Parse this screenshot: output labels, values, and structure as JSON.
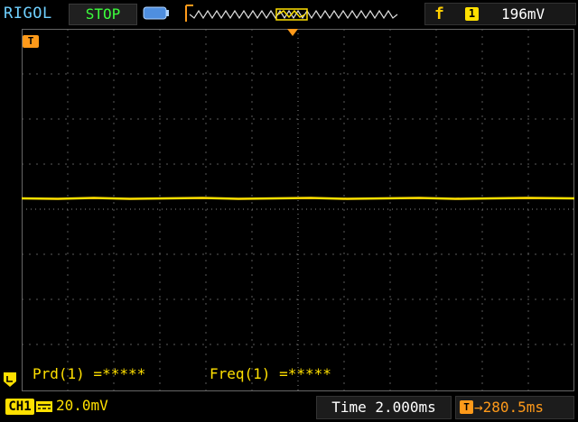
{
  "header": {
    "brand": "RIGOL",
    "run_state": "STOP",
    "trigger_edge_glyph": "f",
    "trigger_channel": "1",
    "trigger_level": "196mV"
  },
  "markers": {
    "trigger_marker": "T"
  },
  "measurements": {
    "period": "Prd(1) =*****",
    "frequency": "Freq(1) =*****"
  },
  "footer": {
    "channel_label": "CH1",
    "volts_per_div": "20.0mV",
    "timebase": "Time 2.000ms",
    "trigger_offset": "→280.5ms",
    "trigger_offset_icon": "T"
  },
  "colors": {
    "trace": "#ffe000",
    "accent_orange": "#ff9a1a",
    "brand_blue": "#6fd0ff",
    "stop_green": "#3cff3c"
  }
}
